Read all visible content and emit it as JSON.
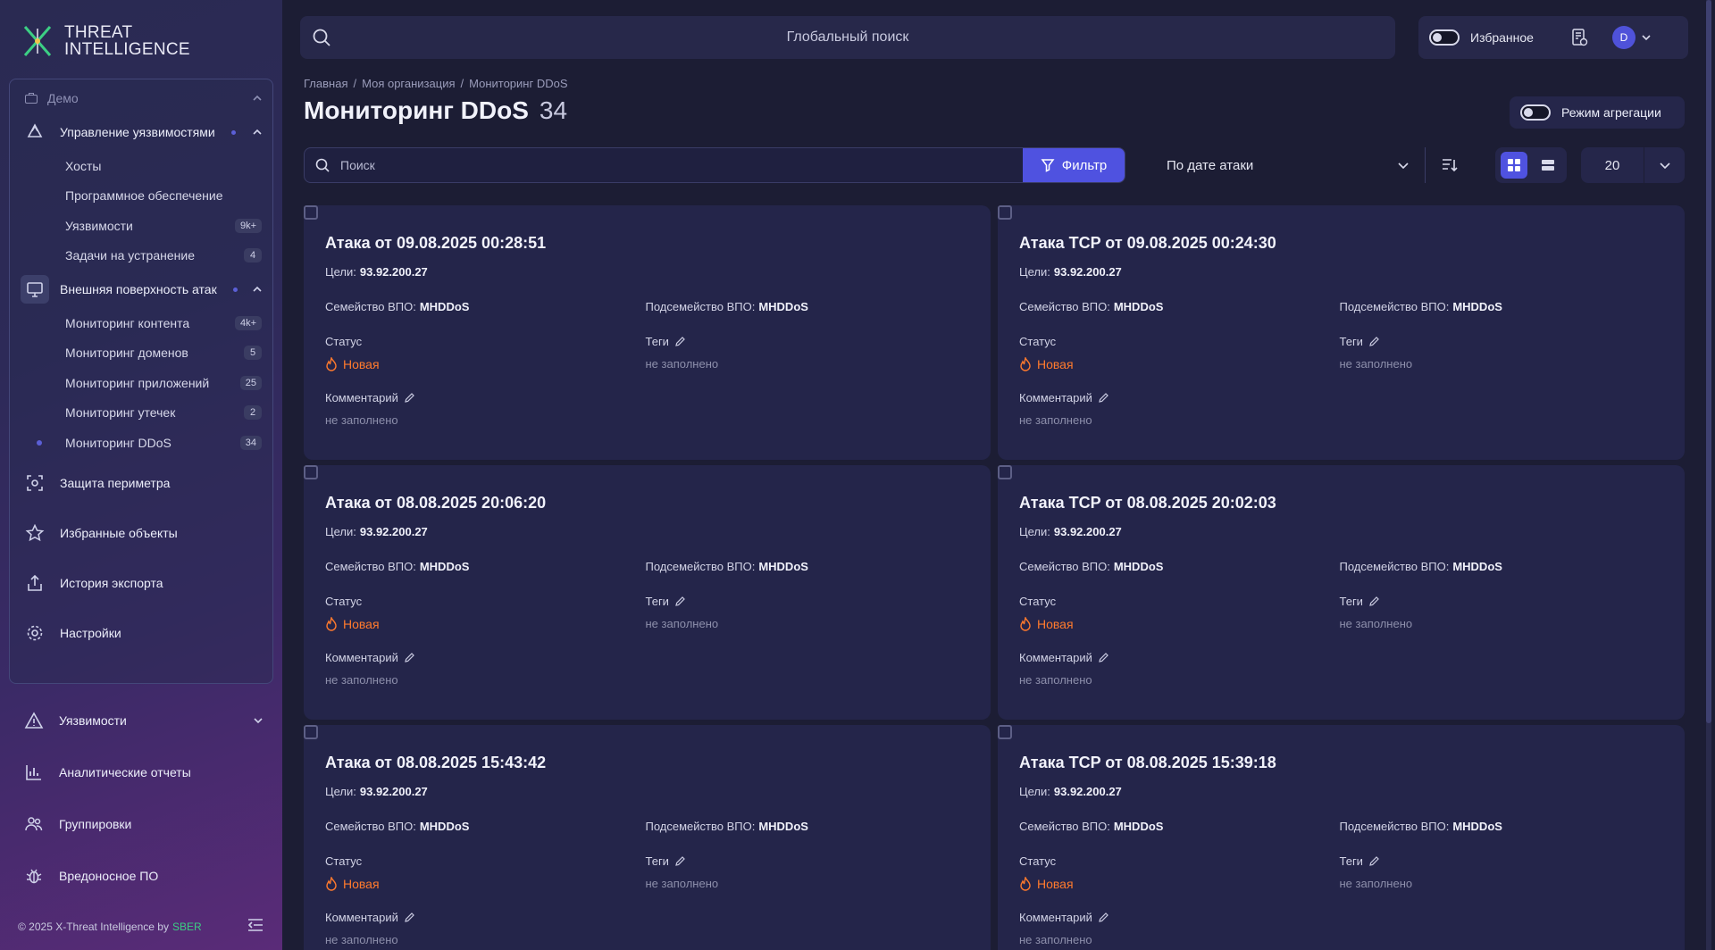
{
  "brand": {
    "line1": "THREAT",
    "line2": "INTELLIGENCE"
  },
  "sidebar": {
    "section_title": "Демо",
    "groups": [
      {
        "label": "Управление уязвимостями",
        "items": [
          {
            "label": "Хосты",
            "badge": ""
          },
          {
            "label": "Программное обеспечение",
            "badge": ""
          },
          {
            "label": "Уязвимости",
            "badge": "9k+"
          },
          {
            "label": "Задачи на устранение",
            "badge": "4"
          }
        ]
      },
      {
        "label": "Внешняя поверхность атак",
        "items": [
          {
            "label": "Мониторинг контента",
            "badge": "4k+"
          },
          {
            "label": "Мониторинг доменов",
            "badge": "5"
          },
          {
            "label": "Мониторинг приложений",
            "badge": "25"
          },
          {
            "label": "Мониторинг утечек",
            "badge": "2"
          },
          {
            "label": "Мониторинг DDoS",
            "badge": "34"
          }
        ]
      }
    ],
    "items": [
      {
        "label": "Защита периметра",
        "icon": "perimeter-icon"
      },
      {
        "label": "Избранные объекты",
        "icon": "star-icon"
      },
      {
        "label": "История экспорта",
        "icon": "export-icon"
      },
      {
        "label": "Настройки",
        "icon": "gear-icon"
      }
    ],
    "lower_items": [
      {
        "label": "Уязвимости",
        "icon": "warning-icon"
      },
      {
        "label": "Аналитические отчеты",
        "icon": "chart-icon"
      },
      {
        "label": "Группировки",
        "icon": "groups-icon"
      },
      {
        "label": "Вредоносное ПО",
        "icon": "bug-icon"
      }
    ],
    "footer": {
      "text": "© 2025 X-Threat Intelligence by",
      "brand": "SBER"
    }
  },
  "topbar": {
    "search_placeholder": "Глобальный поиск",
    "favorites_label": "Избранное",
    "avatar_initial": "D"
  },
  "breadcrumb": [
    "Главная",
    "Моя организация",
    "Мониторинг DDoS"
  ],
  "page": {
    "title": "Мониторинг DDoS",
    "count": "34",
    "aggregation_label": "Режим агрегации"
  },
  "toolbar": {
    "search_placeholder": "Поиск",
    "filter_label": "Фильтр",
    "sort_label": "По дате атаки",
    "page_size": "20"
  },
  "labels": {
    "targets": "Цели:",
    "family": "Семейство ВПО:",
    "subfamily": "Подсемейство ВПО:",
    "status": "Статус",
    "tags": "Теги",
    "comment": "Комментарий",
    "empty": "не заполнено"
  },
  "cards": [
    {
      "title": "Атака от 09.08.2025 00:28:51",
      "target": "93.92.200.27",
      "family": "MHDDoS",
      "subfamily": "MHDDoS",
      "status": "Новая",
      "tags": "не заполнено",
      "comment": "не заполнено"
    },
    {
      "title": "Атака TCP от 09.08.2025 00:24:30",
      "target": "93.92.200.27",
      "family": "MHDDoS",
      "subfamily": "MHDDoS",
      "status": "Новая",
      "tags": "не заполнено",
      "comment": "не заполнено"
    },
    {
      "title": "Атака от 08.08.2025 20:06:20",
      "target": "93.92.200.27",
      "family": "MHDDoS",
      "subfamily": "MHDDoS",
      "status": "Новая",
      "tags": "не заполнено",
      "comment": "не заполнено"
    },
    {
      "title": "Атака TCP от 08.08.2025 20:02:03",
      "target": "93.92.200.27",
      "family": "MHDDoS",
      "subfamily": "MHDDoS",
      "status": "Новая",
      "tags": "не заполнено",
      "comment": "не заполнено"
    },
    {
      "title": "Атака от 08.08.2025 15:43:42",
      "target": "93.92.200.27",
      "family": "MHDDoS",
      "subfamily": "MHDDoS",
      "status": "Новая",
      "tags": "не заполнено",
      "comment": "не заполнено"
    },
    {
      "title": "Атака TCP от 08.08.2025 15:39:18",
      "target": "93.92.200.27",
      "family": "MHDDoS",
      "subfamily": "MHDDoS",
      "status": "Новая",
      "tags": "не заполнено",
      "comment": "не заполнено"
    }
  ],
  "colors": {
    "accent": "#4f52e0",
    "status_new": "#ff7a2d",
    "brand_green": "#3ccf84"
  }
}
